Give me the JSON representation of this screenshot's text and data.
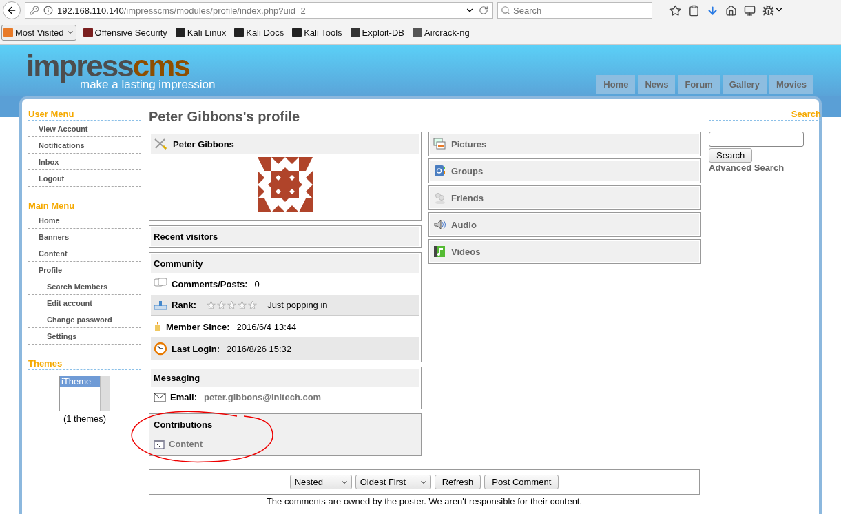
{
  "browser": {
    "url_host": "192.168.110.140",
    "url_path": "/impresscms/modules/profile/index.php?uid=2",
    "search_placeholder": "Search",
    "bookmarks": [
      {
        "label": "Most Visited",
        "kind": "menu"
      },
      {
        "label": "Offensive Security",
        "kind": "link"
      },
      {
        "label": "Kali Linux",
        "kind": "link"
      },
      {
        "label": "Kali Docs",
        "kind": "link"
      },
      {
        "label": "Kali Tools",
        "kind": "link"
      },
      {
        "label": "Exploit-DB",
        "kind": "link"
      },
      {
        "label": "Aircrack-ng",
        "kind": "link"
      }
    ]
  },
  "site": {
    "logo": {
      "dark": "impress",
      "accent": "cms",
      "tagline": "make a lasting impression"
    },
    "nav": [
      "Home",
      "News",
      "Forum",
      "Gallery",
      "Movies"
    ]
  },
  "sidebar": {
    "menus": [
      {
        "title": "User Menu",
        "items": [
          {
            "label": "View Account"
          },
          {
            "label": "Notifications"
          },
          {
            "label": "Inbox"
          },
          {
            "label": "Logout"
          }
        ]
      },
      {
        "title": "Main Menu",
        "items": [
          {
            "label": "Home"
          },
          {
            "label": "Banners"
          },
          {
            "label": "Content"
          },
          {
            "label": "Profile",
            "children": [
              {
                "label": "Search Members"
              },
              {
                "label": "Edit account"
              },
              {
                "label": "Change password"
              },
              {
                "label": "Settings"
              }
            ]
          }
        ]
      }
    ],
    "themes": {
      "title": "Themes",
      "options": [
        {
          "label": "iTheme",
          "selected": true
        }
      ],
      "count": "(1 themes)"
    }
  },
  "profile": {
    "title": "Peter Gibbons's profile",
    "name": "Peter Gibbons",
    "recent_visitors": "Recent visitors",
    "community": {
      "title": "Community",
      "rows": [
        {
          "kind": "comments",
          "label": "Comments/Posts:",
          "value": "0"
        },
        {
          "kind": "rank",
          "label": "Rank:",
          "stars": 0,
          "value": "Just popping in"
        },
        {
          "kind": "member",
          "label": "Member Since:",
          "value": "2016/6/4 13:44"
        },
        {
          "kind": "login",
          "label": "Last Login:",
          "value": "2016/8/26 15:32"
        }
      ]
    },
    "messaging": {
      "title": "Messaging",
      "label": "Email:",
      "value": "peter.gibbons@initech.com"
    },
    "contributions": {
      "title": "Contributions",
      "items": [
        "Content"
      ],
      "circled": true
    },
    "sections": [
      {
        "kind": "pictures",
        "label": "Pictures"
      },
      {
        "kind": "groups",
        "label": "Groups"
      },
      {
        "kind": "friends",
        "label": "Friends"
      },
      {
        "kind": "audio",
        "label": "Audio"
      },
      {
        "kind": "videos",
        "label": "Videos"
      }
    ]
  },
  "search_block": {
    "title": "Search",
    "button": "Search",
    "advanced": "Advanced Search"
  },
  "comments": {
    "mode": "Nested",
    "order": "Oldest First",
    "buttons": [
      "Refresh",
      "Post Comment"
    ],
    "note": "The comments are owned by the poster. We aren't responsible for their content."
  }
}
